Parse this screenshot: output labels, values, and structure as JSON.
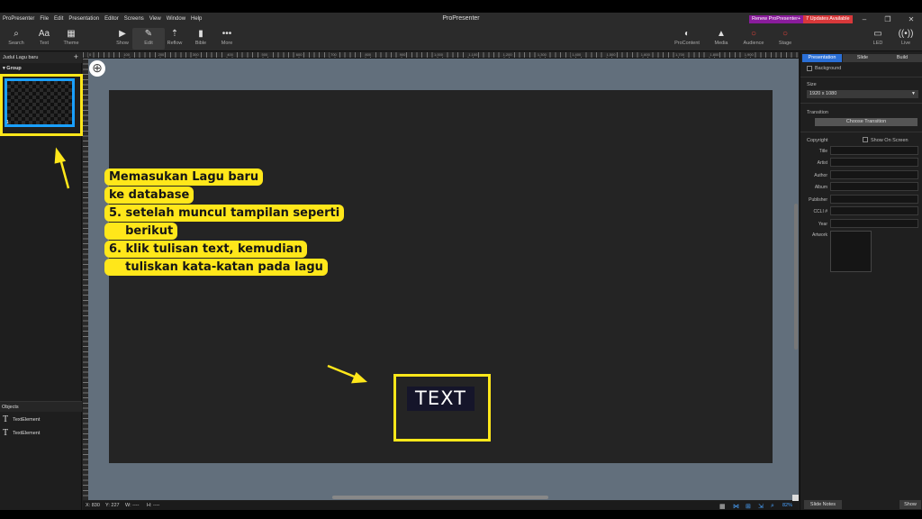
{
  "titlebar": {
    "menus": [
      "ProPresenter",
      "File",
      "Edit",
      "Presentation",
      "Editor",
      "Screens",
      "View",
      "Window",
      "Help"
    ],
    "title": "ProPresenter",
    "renew": "Renew ProPresenter+",
    "updates": "7 Updates Available"
  },
  "toolbar": {
    "left": [
      {
        "label": "Search",
        "icon": "search-icon"
      },
      {
        "label": "Text",
        "icon": "text-icon"
      },
      {
        "label": "Theme",
        "icon": "theme-icon"
      }
    ],
    "center": [
      {
        "label": "Show",
        "icon": "play-icon"
      },
      {
        "label": "Edit",
        "icon": "edit-icon"
      },
      {
        "label": "Reflow",
        "icon": "reflow-icon"
      },
      {
        "label": "Bible",
        "icon": "bible-icon"
      },
      {
        "label": "More",
        "icon": "more-icon"
      }
    ],
    "right": [
      {
        "label": "ProContent",
        "icon": "procontent-icon"
      },
      {
        "label": "Media",
        "icon": "media-icon"
      },
      {
        "label": "Audience",
        "icon": "audience-icon"
      },
      {
        "label": "Stage",
        "icon": "stage-icon"
      }
    ],
    "far_right": [
      {
        "label": "LED",
        "icon": "led-icon"
      },
      {
        "label": "Live",
        "icon": "live-icon"
      }
    ]
  },
  "left_panel": {
    "presentation_name": "Judul Lagu baru",
    "group_label": "Group",
    "slide_number": "1",
    "objects_header": "Objects",
    "objects": [
      "TextElement",
      "TextElement"
    ]
  },
  "ruler_labels": [
    "0",
    "100",
    "200",
    "300",
    "400",
    "500",
    "600",
    "700",
    "800",
    "900",
    "1,000",
    "1,100",
    "1,200",
    "1,300",
    "1,400",
    "1,500",
    "1,600",
    "1,700",
    "1,800",
    "1,900"
  ],
  "annotation": {
    "lines": [
      "Memasukan Lagu baru",
      "ke database",
      "5. setelah muncul tampilan seperti",
      "    berikut",
      "6. klik tulisan text, kemudian",
      "    tuliskan kata-katan pada lagu"
    ]
  },
  "slide_text": "TEXT",
  "statusbar": {
    "x": "X: 830",
    "y": "Y: 227",
    "w": "W: ----",
    "h": "H: ----",
    "zoom": "82%"
  },
  "right_panel": {
    "tabs": [
      "Presentation",
      "Slide",
      "Build"
    ],
    "active_tab": "Presentation",
    "background_label": "Background",
    "size_label": "Size",
    "size_value": "1920 x 1080",
    "transition_label": "Transition",
    "choose_transition": "Choose Transition",
    "copyright_label": "Copyright",
    "show_on_screen": "Show On Screen",
    "fields": [
      "Title",
      "Artist",
      "Author",
      "Album",
      "Publisher",
      "CCLI #",
      "Year"
    ],
    "artwork_label": "Artwork",
    "slide_notes": "Slide Notes",
    "show": "Show"
  },
  "colors": {
    "accent": "#2a6fd6",
    "highlight": "#ffe71a",
    "thumb_border": "#1aa0ff",
    "canvas_bg": "#626f7c"
  }
}
